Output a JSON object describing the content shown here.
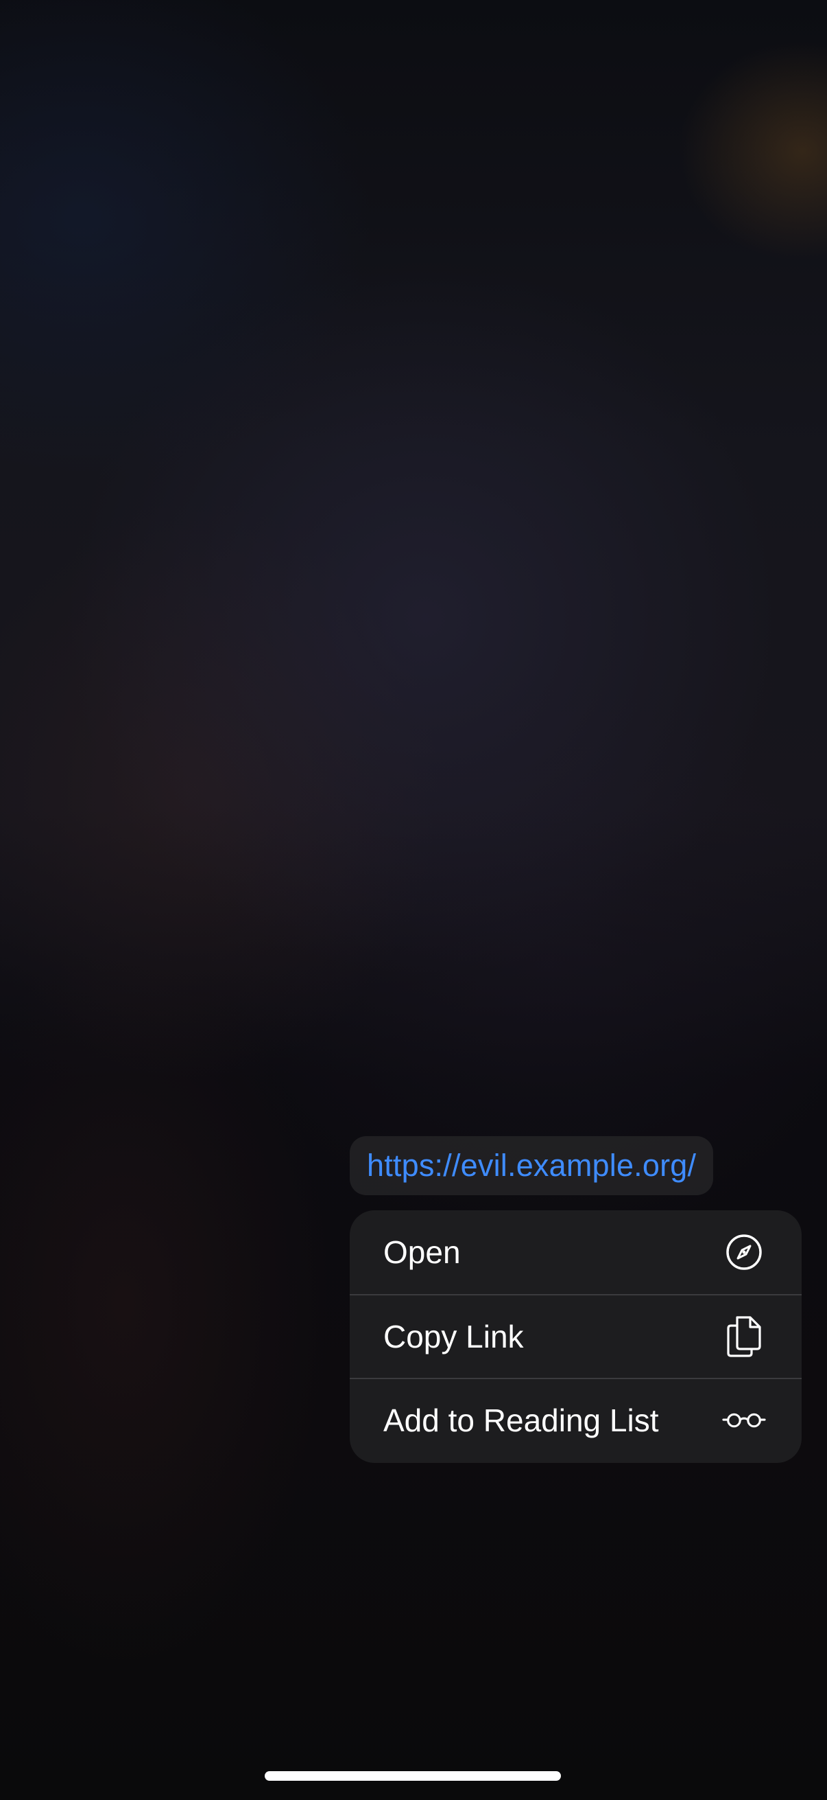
{
  "link_preview": {
    "url": "https://evil.example.org/"
  },
  "context_menu": {
    "items": [
      {
        "label": "Open",
        "icon": "compass-icon"
      },
      {
        "label": "Copy Link",
        "icon": "copy-documents-icon"
      },
      {
        "label": "Add to Reading List",
        "icon": "reading-glasses-icon"
      }
    ]
  },
  "colors": {
    "link": "#3f8cff",
    "menu_background": "#1e1e20",
    "menu_text": "#ffffff"
  }
}
